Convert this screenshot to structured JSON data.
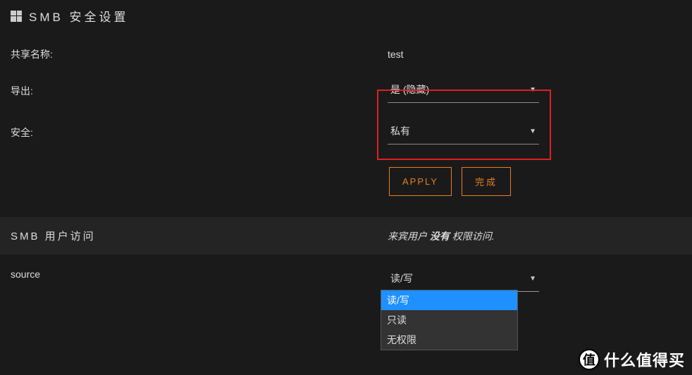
{
  "header": {
    "title": "SMB 安全设置"
  },
  "form": {
    "share_name_label": "共享名称:",
    "share_name_value": "test",
    "export_label": "导出:",
    "export_value": "是 (隐藏)",
    "security_label": "安全:",
    "security_value": "私有"
  },
  "buttons": {
    "apply": "APPLY",
    "done": "完成"
  },
  "user_access": {
    "section_title": "SMB 用户访问",
    "note_prefix": "来宾用户 ",
    "note_bold": "没有",
    "note_suffix": " 权限访问."
  },
  "source": {
    "label": "source",
    "selected": "读/写",
    "options": [
      "读/写",
      "只读",
      "无权限"
    ]
  },
  "watermark": {
    "badge": "值",
    "text": "什么值得买"
  },
  "colors": {
    "accent": "#e67e22",
    "highlight_border": "#e02020",
    "dropdown_active": "#1e90ff"
  }
}
